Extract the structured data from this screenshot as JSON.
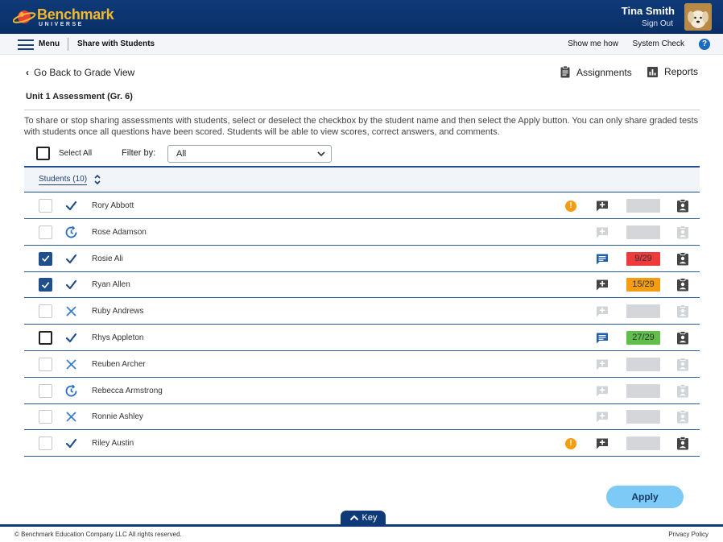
{
  "header": {
    "logo_word": "Benchmark",
    "logo_sub": "UNIVERSE",
    "user_name": "Tina Smith",
    "sign_out": "Sign Out"
  },
  "nav": {
    "menu": "Menu",
    "page": "Share with Students",
    "show_me_how": "Show me how",
    "system_check": "System Check",
    "help": "?"
  },
  "toolbar": {
    "back": "Go Back to Grade View",
    "assignments": "Assignments",
    "reports": "Reports"
  },
  "assessment_title": "Unit 1 Assessment (Gr. 6)",
  "instructions": "To share or stop sharing assessments with students, select or deselect the checkbox by the student name and then select the Apply button. You can only share graded tests with students once all questions have been scored. Students will be able to view scores, correct answers, and comments.",
  "controls": {
    "select_all": "Select All",
    "filter_label": "Filter by:",
    "filter_value": "All"
  },
  "table": {
    "students_header": "Students (10)",
    "rows": [
      {
        "name": "Rory Abbott",
        "checkbox": "unchecked",
        "status": "complete",
        "warning": true,
        "comment": "add",
        "comment_enabled": true,
        "score": "",
        "report_enabled": true
      },
      {
        "name": "Rose Adamson",
        "checkbox": "unchecked",
        "status": "in-progress",
        "warning": false,
        "comment": "add",
        "comment_enabled": false,
        "score": "",
        "report_enabled": false
      },
      {
        "name": "Rosie Ali",
        "checkbox": "checked",
        "status": "complete",
        "warning": false,
        "comment": "view",
        "comment_enabled": true,
        "score": "9/29",
        "score_color": "#ee3b3b",
        "report_enabled": true
      },
      {
        "name": "Ryan Allen",
        "checkbox": "checked",
        "status": "complete",
        "warning": false,
        "comment": "add",
        "comment_enabled": true,
        "score": "15/29",
        "score_color": "#f59d12",
        "report_enabled": true
      },
      {
        "name": "Ruby Andrews",
        "checkbox": "unchecked",
        "status": "not-started",
        "warning": false,
        "comment": "add",
        "comment_enabled": false,
        "score": "",
        "report_enabled": false
      },
      {
        "name": "Rhys Appleton",
        "checkbox": "focused",
        "status": "complete",
        "warning": false,
        "comment": "view",
        "comment_enabled": true,
        "score": "27/29",
        "score_color": "#5fbf4a",
        "report_enabled": true
      },
      {
        "name": "Reuben Archer",
        "checkbox": "unchecked",
        "status": "not-started",
        "warning": false,
        "comment": "add",
        "comment_enabled": false,
        "score": "",
        "report_enabled": false
      },
      {
        "name": "Rebecca Armstrong",
        "checkbox": "unchecked",
        "status": "in-progress",
        "warning": false,
        "comment": "add",
        "comment_enabled": false,
        "score": "",
        "report_enabled": false
      },
      {
        "name": "Ronnie Ashley",
        "checkbox": "unchecked",
        "status": "not-started",
        "warning": false,
        "comment": "add",
        "comment_enabled": false,
        "score": "",
        "report_enabled": false
      },
      {
        "name": "Riley Austin",
        "checkbox": "unchecked",
        "status": "complete",
        "warning": true,
        "comment": "add",
        "comment_enabled": true,
        "score": "",
        "report_enabled": true
      }
    ]
  },
  "apply": "Apply",
  "key": "Key",
  "footer": {
    "copyright": "© Benchmark Education Company LLC All rights reserved.",
    "privacy": "Privacy Policy"
  },
  "colors": {
    "brand_navy": "#0e3a78",
    "check_blue": "#1f4f8c",
    "accent_blue": "#1a6bc2",
    "apply_button": "#7ccaf5",
    "warning": "#f59d12"
  },
  "icons": {
    "status_complete": "checkmark-icon",
    "status_in_progress": "clock-refresh-icon",
    "status_not_started": "x-icon",
    "comment_add": "comment-add-icon",
    "comment_view": "comment-view-icon",
    "report": "clipboard-person-icon"
  }
}
